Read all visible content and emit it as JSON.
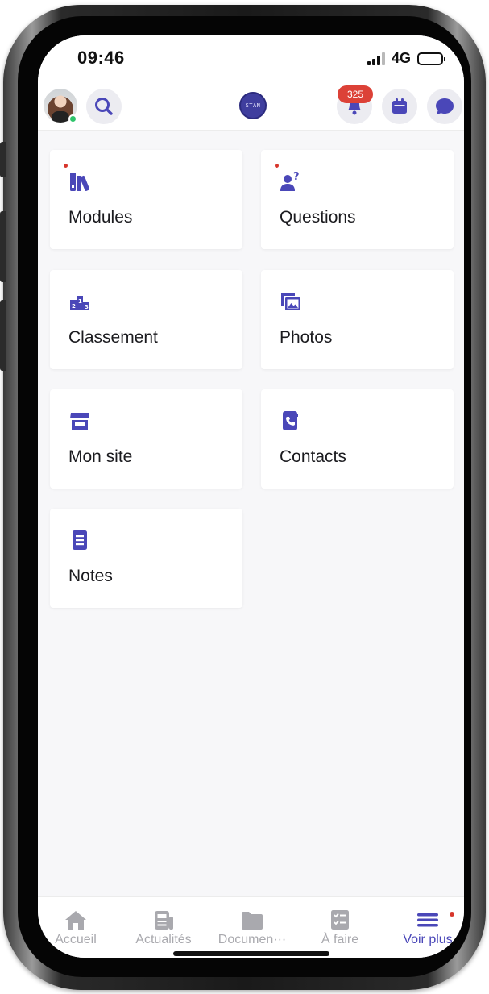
{
  "status_bar": {
    "time": "09:46",
    "network": "4G"
  },
  "header": {
    "notification_count": "325",
    "logo_text": "STAN"
  },
  "menu": [
    {
      "label": "Modules",
      "icon": "books-icon",
      "has_dot": true
    },
    {
      "label": "Questions",
      "icon": "person-question-icon",
      "has_dot": true
    },
    {
      "label": "Classement",
      "icon": "podium-icon",
      "has_dot": false
    },
    {
      "label": "Photos",
      "icon": "photos-icon",
      "has_dot": false
    },
    {
      "label": "Mon site",
      "icon": "storefront-icon",
      "has_dot": false
    },
    {
      "label": "Contacts",
      "icon": "phone-book-icon",
      "has_dot": false
    },
    {
      "label": "Notes",
      "icon": "notes-icon",
      "has_dot": false
    }
  ],
  "tabs": [
    {
      "label": "Accueil",
      "icon": "home-icon",
      "active": false
    },
    {
      "label": "Actualités",
      "icon": "newspaper-icon",
      "active": false
    },
    {
      "label": "Documen···",
      "icon": "folder-icon",
      "active": false
    },
    {
      "label": "À faire",
      "icon": "checklist-icon",
      "active": false
    },
    {
      "label": "Voir plus",
      "icon": "menu-icon",
      "active": true
    }
  ],
  "colors": {
    "accent": "#4a47b8",
    "badge": "#dc4137",
    "dot": "#d7362c",
    "online": "#2ec46b",
    "inactive_tab": "#a9a9ae"
  }
}
